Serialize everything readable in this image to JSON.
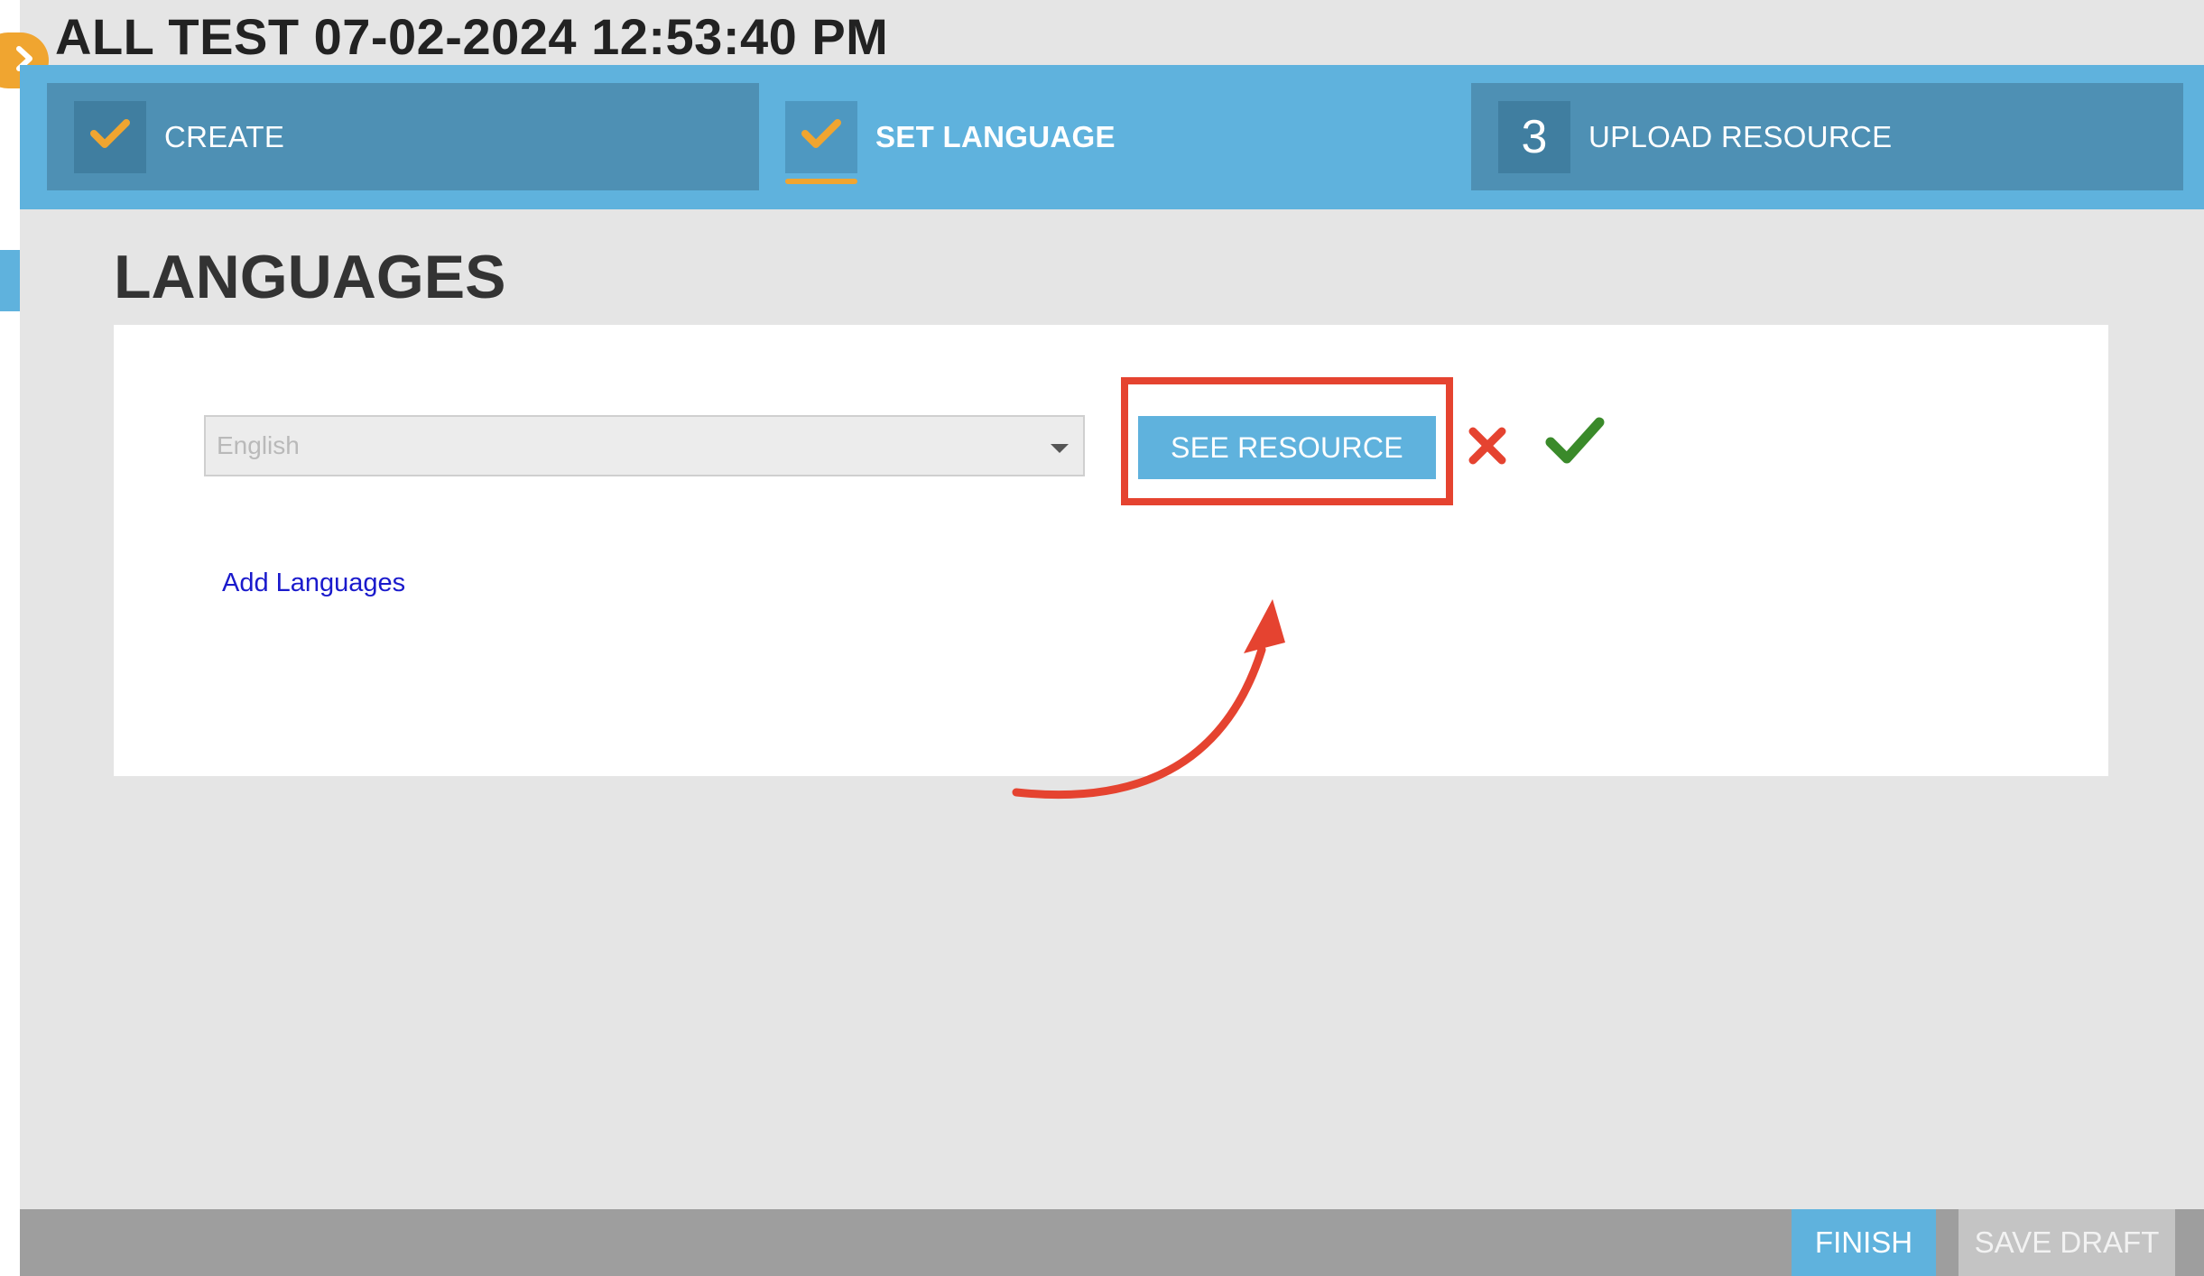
{
  "page": {
    "title": "ALL TEST 07-02-2024 12:53:40 PM"
  },
  "steps": [
    {
      "badge_icon": "check-icon",
      "label": "CREATE",
      "state": "done"
    },
    {
      "badge_icon": "check-icon",
      "label": "SET LANGUAGE",
      "state": "active"
    },
    {
      "badge_number": "3",
      "label": "UPLOAD RESOURCE",
      "state": "pending"
    }
  ],
  "languages": {
    "heading": "LANGUAGES",
    "selected_language": "English",
    "see_resource_label": "SEE RESOURCE",
    "add_languages_label": "Add Languages"
  },
  "footer": {
    "finish_label": "FINISH",
    "save_draft_label": "SAVE DRAFT"
  },
  "colors": {
    "accent_blue": "#5fb2dd",
    "step_done": "#4e90b4",
    "check_orange": "#f0a530",
    "annotation_red": "#e54330",
    "confirm_green": "#3a8a2a"
  }
}
